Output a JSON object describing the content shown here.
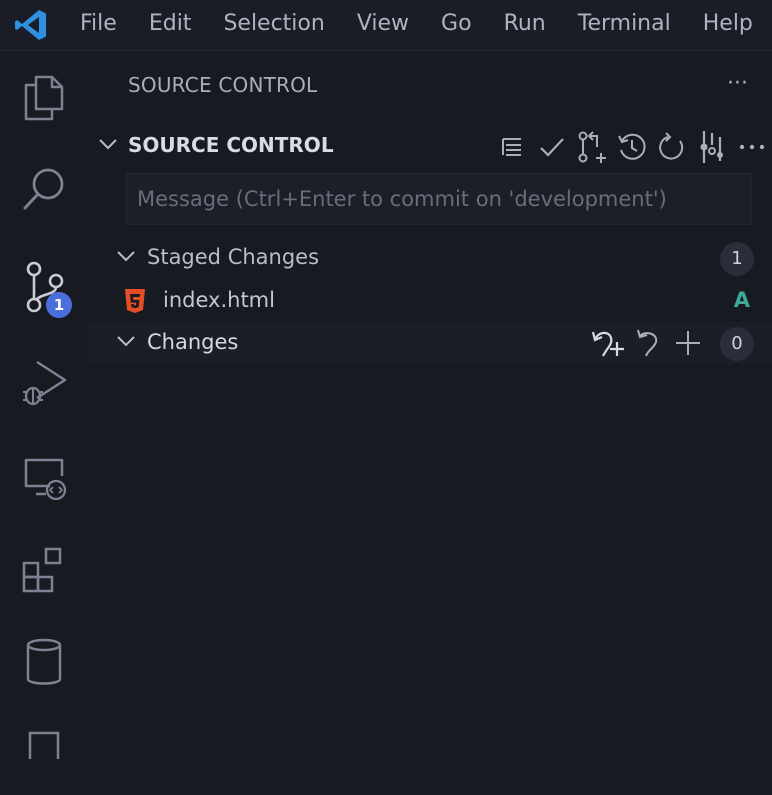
{
  "menubar": {
    "items": [
      "File",
      "Edit",
      "Selection",
      "View",
      "Go",
      "Run",
      "Terminal",
      "Help"
    ]
  },
  "activity_bar": {
    "items": [
      {
        "id": "explorer",
        "icon": "files-icon"
      },
      {
        "id": "search",
        "icon": "search-icon"
      },
      {
        "id": "source-control",
        "icon": "source-control-icon",
        "badge": "1",
        "active": true
      },
      {
        "id": "run-debug",
        "icon": "run-debug-icon"
      },
      {
        "id": "remote-explorer",
        "icon": "remote-explorer-icon"
      },
      {
        "id": "extensions",
        "icon": "extensions-icon"
      },
      {
        "id": "database",
        "icon": "database-icon"
      }
    ]
  },
  "panel": {
    "header": "SOURCE CONTROL",
    "more": "···",
    "section": {
      "title": "SOURCE CONTROL",
      "actions": [
        "view-as-tree-icon",
        "commit-check-icon",
        "pull-request-icon",
        "history-icon",
        "refresh-icon",
        "graph-icon",
        "more-icon"
      ]
    },
    "message": {
      "placeholder": "Message (Ctrl+Enter to commit on 'development')",
      "value": ""
    },
    "staged": {
      "label": "Staged Changes",
      "count": "1",
      "files": [
        {
          "name": "index.html",
          "status": "A",
          "icon": "html5-icon"
        }
      ]
    },
    "changes": {
      "label": "Changes",
      "count": "0",
      "actions": [
        "open-changes-icon",
        "discard-icon",
        "stage-all-icon"
      ]
    }
  },
  "colors": {
    "background": "#181a22",
    "accent_badge": "#4a6fdc",
    "html_icon": "#e44d26",
    "added_status": "#3ea89b",
    "vscode_logo": "#2f8fe0"
  }
}
